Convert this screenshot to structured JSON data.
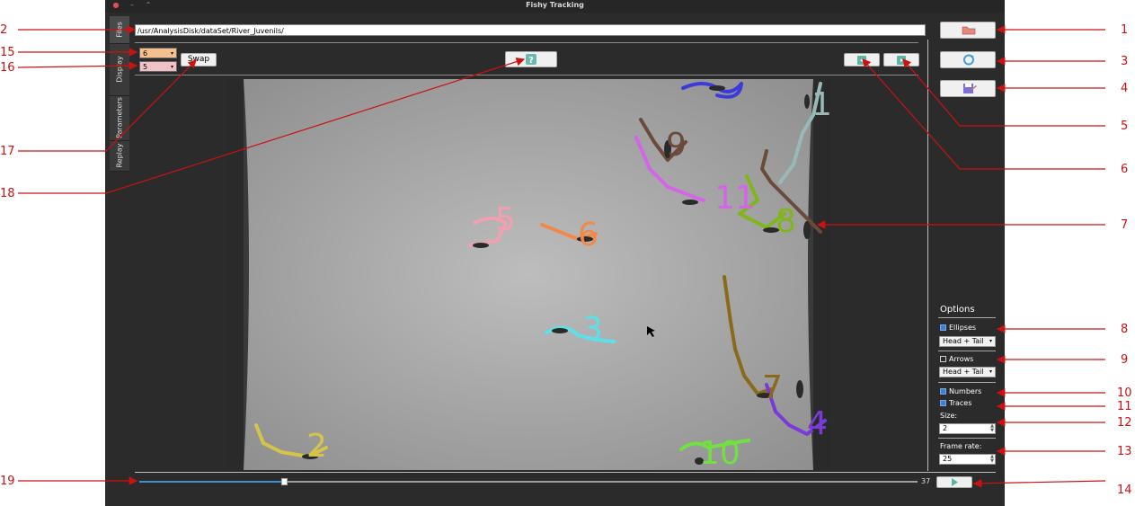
{
  "window": {
    "title": "Fishy Tracking"
  },
  "tabs": [
    {
      "label": "Files"
    },
    {
      "label": "Display"
    },
    {
      "label": "Parameters"
    },
    {
      "label": "Replay"
    }
  ],
  "path": {
    "value": "/usr/AnalysisDisk/dataSet/River_Juvenils/"
  },
  "toolbar": {
    "combo1_value": "6",
    "combo2_value": "5",
    "swap_label": "Swap",
    "help_label": "?"
  },
  "options": {
    "title": "Options",
    "ellipses": {
      "label": "Ellipses",
      "checked": true,
      "mode": "Head + Tail"
    },
    "arrows": {
      "label": "Arrows",
      "checked": false,
      "mode": "Head + Tail"
    },
    "numbers": {
      "label": "Numbers",
      "checked": true
    },
    "traces": {
      "label": "Traces",
      "checked": true
    },
    "size": {
      "label": "Size:",
      "value": "2"
    },
    "frame_rate": {
      "label": "Frame rate:",
      "value": "25"
    }
  },
  "replay": {
    "frame": "37",
    "progress": 0.19
  },
  "fish_labels": [
    "1",
    "2",
    "3",
    "4",
    "5",
    "6",
    "7",
    "8",
    "9",
    "10",
    "11"
  ],
  "callouts": [
    "1",
    "2",
    "3",
    "4",
    "5",
    "6",
    "7",
    "8",
    "9",
    "10",
    "11",
    "12",
    "13",
    "14",
    "15",
    "16",
    "17",
    "18",
    "19"
  ],
  "colors": {
    "annotation": "#cc1111",
    "accent": "#3d7fd6"
  }
}
